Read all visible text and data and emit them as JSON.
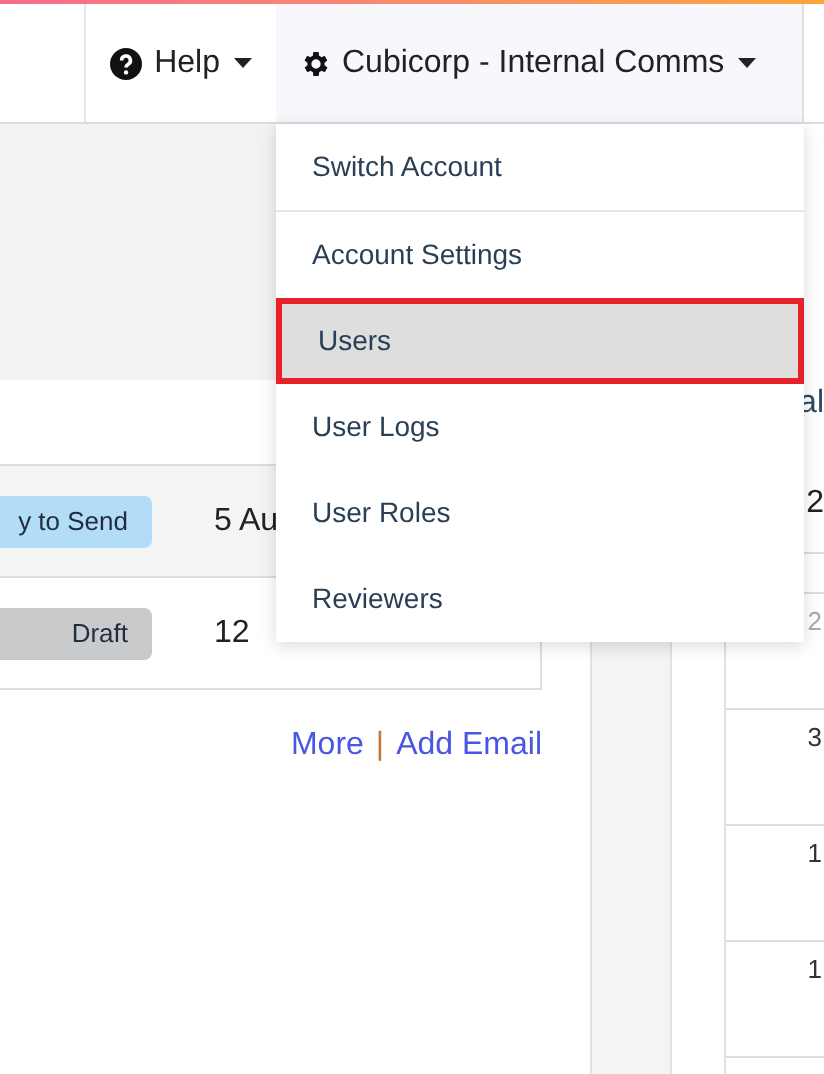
{
  "header": {
    "help": {
      "label": "Help"
    },
    "account": {
      "label": "Cubicorp - Internal Comms"
    }
  },
  "account_menu": {
    "items": [
      {
        "label": "Switch Account",
        "selected": false
      },
      {
        "label": "Account Settings",
        "selected": false
      },
      {
        "label": "Users",
        "selected": true
      },
      {
        "label": "User Logs",
        "selected": false
      },
      {
        "label": "User Roles",
        "selected": false
      },
      {
        "label": "Reviewers",
        "selected": false
      }
    ]
  },
  "emails": {
    "rows": [
      {
        "status": "y to Send",
        "kind": "ready",
        "date": "5 Au"
      },
      {
        "status": "Draft",
        "kind": "draft",
        "date": "12"
      }
    ],
    "links": [
      "More",
      "Add Email"
    ],
    "link_separator": "|"
  },
  "calendar": {
    "title": "al",
    "year": "2",
    "dates": [
      "2",
      "3",
      "1",
      "1"
    ]
  }
}
